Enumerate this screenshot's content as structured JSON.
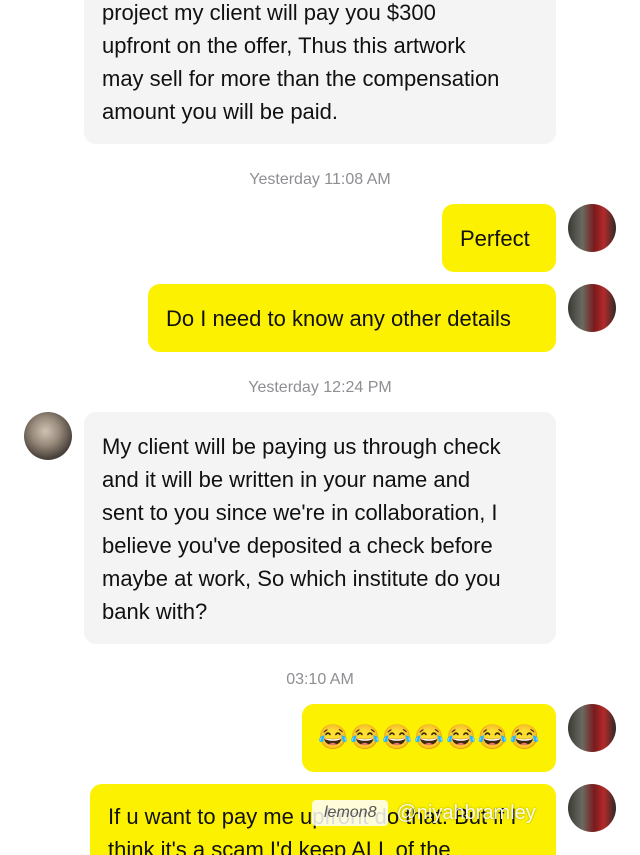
{
  "messages": [
    {
      "id": "m1",
      "direction": "incoming",
      "lines": [
        "project my client will pay you $300",
        "upfront on the offer, Thus this artwork",
        "may sell for more than the compensation",
        "amount you will be paid."
      ]
    },
    {
      "id": "ts1",
      "type": "timestamp",
      "text": "Yesterday 11:08 AM"
    },
    {
      "id": "m2",
      "direction": "outgoing",
      "text": "Perfect"
    },
    {
      "id": "m3",
      "direction": "outgoing",
      "text": "Do I need to know any other details"
    },
    {
      "id": "ts2",
      "type": "timestamp",
      "text": "Yesterday 12:24 PM"
    },
    {
      "id": "m4",
      "direction": "incoming",
      "lines": [
        "My client will be paying us through check",
        "and it will be written in your name and",
        "sent to you since we're in collaboration, I",
        "believe you've deposited a check before",
        "maybe at work, So which institute do you",
        "bank with?"
      ]
    },
    {
      "id": "ts3",
      "type": "timestamp",
      "text": "03:10 AM"
    },
    {
      "id": "m5",
      "direction": "outgoing",
      "emoji": [
        "😂",
        "😂",
        "😂",
        "😂",
        "😂",
        "😂",
        "😂"
      ]
    },
    {
      "id": "m6",
      "direction": "outgoing",
      "lines": [
        "If u want to pay me upfront do that. But if I",
        "think it's a scam I'd keep ALL of the"
      ]
    }
  ],
  "watermark": {
    "logo": "lemon8",
    "username": "@niyahbramley"
  },
  "colors": {
    "outgoing_bubble": "#fbf100",
    "incoming_bubble": "#f4f4f5",
    "timestamp_text": "#8e8e93"
  }
}
